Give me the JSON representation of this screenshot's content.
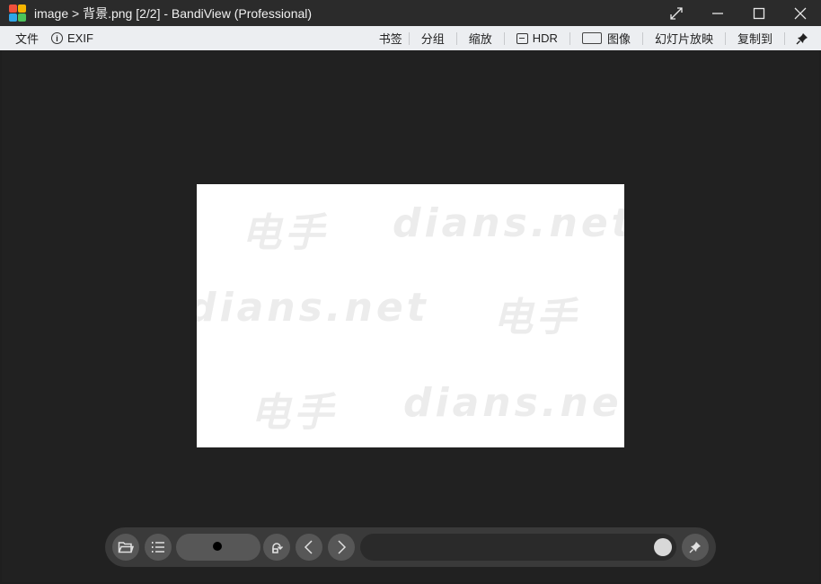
{
  "window": {
    "title": "image > 背景.png [2/2] - BandiView (Professional)"
  },
  "menu": {
    "file": "文件",
    "exif": "EXIF",
    "bookmark": "书签",
    "split": "分组",
    "zoom": "缩放",
    "hdr": "HDR",
    "image": "图像",
    "slideshow": "幻灯片放映",
    "copy_to": "复制到"
  },
  "watermark": {
    "cn": "电手",
    "url": "dians.net"
  },
  "colors": {
    "viewer_bg": "#212121",
    "titlebar_bg": "#2b2b2b",
    "menubar_bg": "#eceef1"
  },
  "slider": {
    "position": 1.0
  }
}
